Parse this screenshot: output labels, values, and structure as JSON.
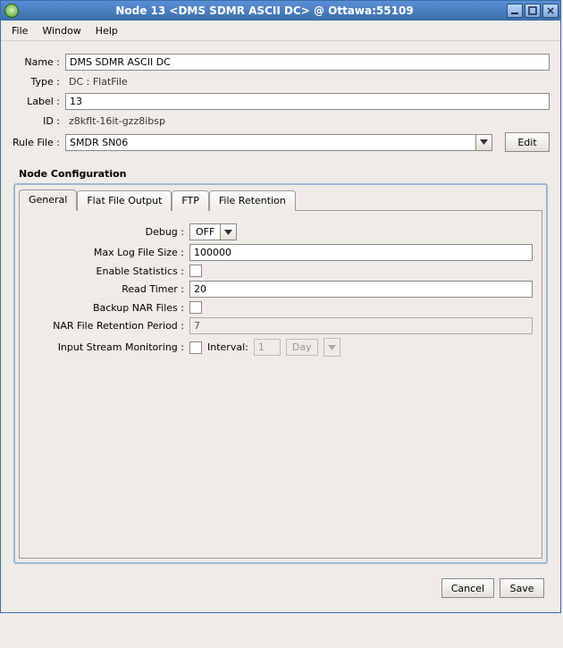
{
  "window": {
    "title": "Node 13 <DMS SDMR ASCII DC> @ Ottawa:55109"
  },
  "menubar": {
    "file": "File",
    "window": "Window",
    "help": "Help"
  },
  "form": {
    "name_label": "Name :",
    "name_value": "DMS SDMR ASCII DC",
    "type_label": "Type :",
    "type_value": "DC : FlatFile",
    "label_label": "Label :",
    "label_value": "13",
    "id_label": "ID :",
    "id_value": "z8kflt-16it-gzz8ibsp",
    "rulefile_label": "Rule File :",
    "rulefile_value": "SMDR SN06",
    "edit_btn": "Edit"
  },
  "node_config": {
    "section_title": "Node Configuration",
    "tabs": {
      "general": "General",
      "flatfile": "Flat File Output",
      "ftp": "FTP",
      "retention": "File Retention"
    },
    "general": {
      "debug_label": "Debug :",
      "debug_value": "OFF",
      "maxlog_label": "Max Log File Size :",
      "maxlog_value": "100000",
      "stats_label": "Enable Statistics :",
      "readtimer_label": "Read Timer :",
      "readtimer_value": "20",
      "backupnar_label": "Backup NAR Files :",
      "narperiod_label": "NAR File Retention Period :",
      "narperiod_value": "7",
      "ism_label": "Input Stream Monitoring :",
      "ism_interval_label": "Interval:",
      "ism_interval_value": "1",
      "ism_unit_value": "Day"
    }
  },
  "buttons": {
    "cancel": "Cancel",
    "save": "Save"
  }
}
